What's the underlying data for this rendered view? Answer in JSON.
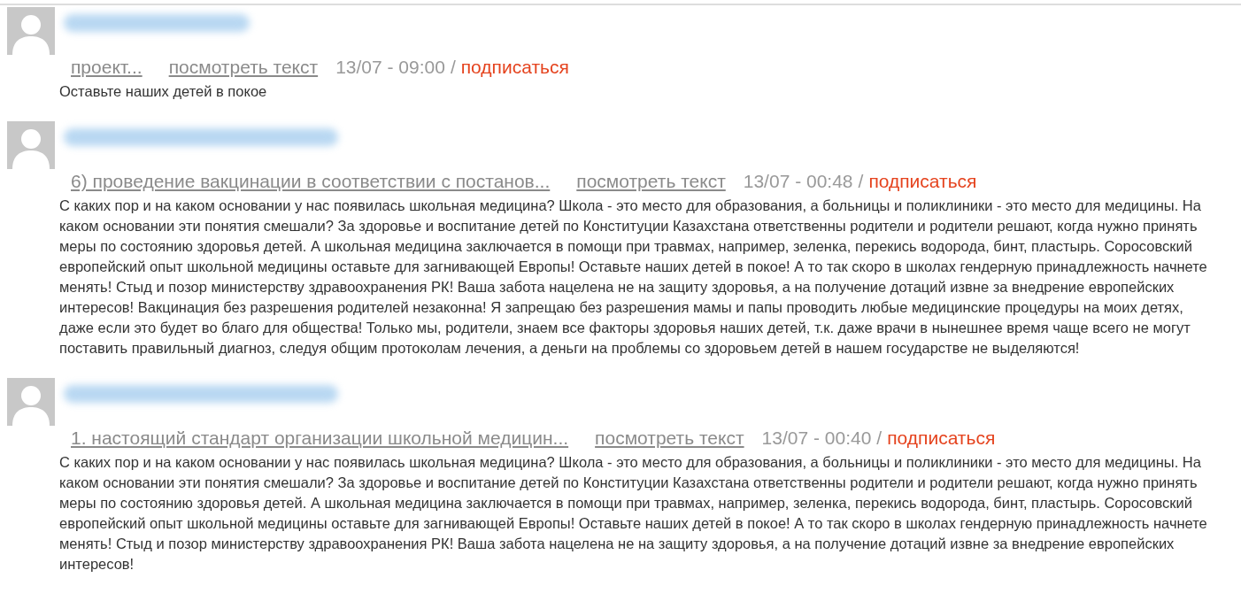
{
  "comments": [
    {
      "title": "проект...",
      "view_link": "посмотреть текст",
      "date": "13/07 - 09:00",
      "separator": "/",
      "subscribe": "подписаться",
      "text": "Оставьте наших детей в покое"
    },
    {
      "title": "6) проведение вакцинации в соответствии с постанов...",
      "view_link": "посмотреть текст",
      "date": "13/07 - 00:48",
      "separator": "/",
      "subscribe": "подписаться",
      "text": "С каких пор и на каком основании у нас появилась школьная медицина? Школа - это место для образования, а больницы и поликлиники - это место для медицины. На каком основании эти понятия смешали? За здоровье и воспитание детей по Конституции Казахстана ответственны родители и родители решают, когда нужно принять меры по состоянию здоровья детей. А школьная медицина заключается в помощи при травмах, например, зеленка, перекись водорода, бинт, пластырь. Соросовский европейский опыт школьной медицины оставьте для загнивающей Европы! Оставьте наших детей в покое! А то так скоро в школах гендерную принадлежность начнете менять! Стыд и позор министерству здравоохранения РК! Ваша забота нацелена не на защиту здоровья, а на получение дотаций извне за внедрение европейских интересов! Вакцинация без разрешения родителей незаконна! Я запрещаю без разрешения мамы и папы проводить любые медицинские процедуры на моих детях, даже если это будет во благо для общества! Только мы, родители, знаем все факторы здоровья наших детей, т.к. даже врачи в нынешнее время чаще всего не могут поставить правильный диагноз, следуя общим протоколам лечения, а деньги на проблемы со здоровьем детей в нашем государстве не выделяются!"
    },
    {
      "title": "1. настоящий стандарт организации школьной медицин...",
      "view_link": "посмотреть текст",
      "date": "13/07 - 00:40",
      "separator": "/",
      "subscribe": "подписаться",
      "text": "С каких пор и на каком основании у нас появилась школьная медицина? Школа - это место для образования, а больницы и поликлиники - это место для медицины. На каком основании эти понятия смешали? За здоровье и воспитание детей по Конституции Казахстана ответственны родители и родители решают, когда нужно принять меры по состоянию здоровья детей. А школьная медицина заключается в помощи при травмах, например, зеленка, перекись водорода, бинт, пластырь. Соросовский европейский опыт школьной медицины оставьте для загнивающей Европы! Оставьте наших детей в покое! А то так скоро в школах гендерную принадлежность начнете менять! Стыд и позор министерству здравоохранения РК! Ваша забота нацелена не на защиту здоровья, а на получение дотаций извне за внедрение европейских интересов!"
    }
  ]
}
